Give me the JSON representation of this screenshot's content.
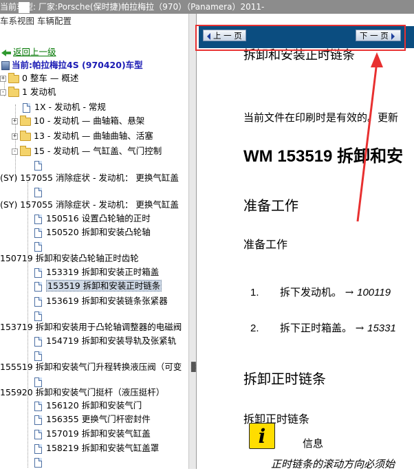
{
  "window": {
    "title": "当前车型:   厂家:Porsche(保时捷)帕拉梅拉（970）（Panamera）2011-"
  },
  "tree": {
    "top_cut": "车系视图   车辆配置",
    "back_link": "返回上一级",
    "current_label": "当前:帕拉梅拉4S (970420)车型",
    "items": [
      {
        "text": "0 整车 — 概述",
        "type": "folder",
        "pm": "+"
      },
      {
        "text": "1 发动机",
        "type": "folder",
        "pm": "-"
      },
      {
        "text": "1X - 发动机 - 常规",
        "type": "doc"
      },
      {
        "text": "10 - 发动机 — 曲轴箱、悬架",
        "type": "folder",
        "pm": "+"
      },
      {
        "text": "13 - 发动机 — 曲轴曲轴、活塞",
        "type": "folder",
        "pm": "+"
      },
      {
        "text": "15 - 发动机 — 气缸盖、气门控制",
        "type": "folder",
        "pm": "-"
      },
      {
        "text": "",
        "type": "doc"
      },
      {
        "text": "(SY) 157055 消除症状 - 发动机：  更换气缸盖",
        "type": "text"
      },
      {
        "text": "",
        "type": "doc"
      },
      {
        "text": "(SY) 157055 消除症状 - 发动机：  更换气缸盖",
        "type": "text"
      },
      {
        "text": "150516 设置凸轮轴的正时",
        "type": "doc"
      },
      {
        "text": "150520 拆卸和安装凸轮轴",
        "type": "doc"
      },
      {
        "text": "",
        "type": "doc"
      },
      {
        "text": "150719 拆卸和安装凸轮轴正时齿轮",
        "type": "text"
      },
      {
        "text": "153319 拆卸和安装正时箱盖",
        "type": "doc"
      },
      {
        "text": "153519 拆卸和安装正时链条",
        "type": "doc",
        "selected": true
      },
      {
        "text": "153619 拆卸和安装链条张紧器",
        "type": "doc"
      },
      {
        "text": "",
        "type": "doc"
      },
      {
        "text": "153719 拆卸和安装用于凸轮轴调整器的电磁阀",
        "type": "text"
      },
      {
        "text": "154719 拆卸和安装导轨及张紧轨",
        "type": "doc"
      },
      {
        "text": "",
        "type": "doc"
      },
      {
        "text": "155519 拆卸和安装气门升程转换液压阀（可变",
        "type": "text"
      },
      {
        "text": "",
        "type": "doc"
      },
      {
        "text": "155920 拆卸和安装气门挺杆（液压挺杆）",
        "type": "text"
      },
      {
        "text": "156120 拆卸和安装气门",
        "type": "doc"
      },
      {
        "text": "156355 更换气门杆密封件",
        "type": "doc"
      },
      {
        "text": "157019 拆卸和安装气缸盖",
        "type": "doc"
      },
      {
        "text": "158219 拆卸和安装气缸盖罩",
        "type": "doc"
      },
      {
        "text": "",
        "type": "doc"
      }
    ]
  },
  "nav": {
    "prev_label": "上 一 页",
    "next_label": "下 一 页"
  },
  "document": {
    "title": "拆卸和安装正时链条",
    "valid_note": "当前文件在印刷时是有效的。更新",
    "heading": "WM 153519 拆卸和安",
    "section1": "准备工作",
    "subsection1": "准备工作",
    "steps": [
      {
        "num": "1.",
        "text": "拆下发动机。 → ",
        "ref": "100119"
      },
      {
        "num": "2.",
        "text": "拆下正时箱盖。 → ",
        "ref": "15331"
      }
    ],
    "section2": "拆卸正时链条",
    "subsection2": "拆卸正时链条",
    "info_glyph": "i",
    "info_label": "信息",
    "cut_text": "正时链条的滚动方向必须始"
  },
  "annotation": {
    "highlight_color": "#e83030"
  }
}
